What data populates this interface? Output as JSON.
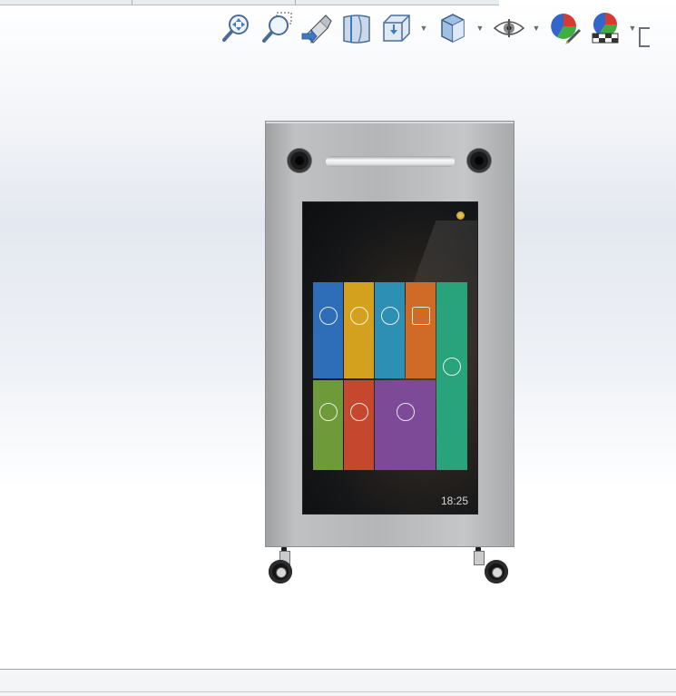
{
  "toolbar": {
    "buttons": [
      {
        "name": "zoom-to-fit-icon",
        "has_dropdown": false
      },
      {
        "name": "zoom-to-area-icon",
        "has_dropdown": false
      },
      {
        "name": "previous-view-icon",
        "has_dropdown": false
      },
      {
        "name": "section-view-icon",
        "has_dropdown": false
      },
      {
        "name": "view-orientation-icon",
        "has_dropdown": true
      },
      {
        "name": "display-style-icon",
        "has_dropdown": true
      },
      {
        "name": "hide-show-items-icon",
        "has_dropdown": true
      },
      {
        "name": "edit-appearance-icon",
        "has_dropdown": false
      },
      {
        "name": "apply-scene-icon",
        "has_dropdown": true
      }
    ],
    "caret_glyph": "▼"
  },
  "kiosk_screen": {
    "status_text": "",
    "logo_text": "",
    "nav_tabs": [
      "",
      "",
      "",
      "",
      ""
    ],
    "active_tab_index": 4,
    "tiles": [
      {
        "label": "",
        "color": "#2e6db8"
      },
      {
        "label": "",
        "color": "#d4a11f"
      },
      {
        "label": "",
        "color": "#2e8fb5"
      },
      {
        "label": "",
        "color": "#d06a27"
      },
      {
        "label": "",
        "color": "#28a37c"
      },
      {
        "label": "",
        "color": "#6e9a3a"
      },
      {
        "label": "",
        "color": "#c5472e"
      },
      {
        "label": "",
        "color": "#7c4a97"
      }
    ],
    "clock": {
      "date": "",
      "time": "18:25"
    }
  }
}
